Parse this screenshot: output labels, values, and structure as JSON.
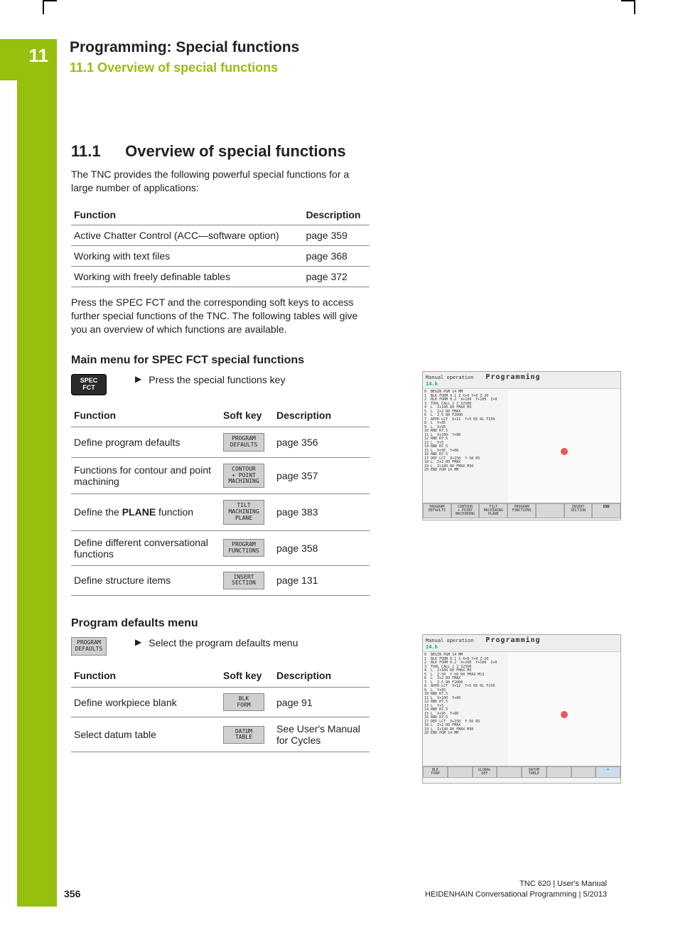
{
  "tab_number": "11",
  "header": {
    "chapter": "Programming: Special functions",
    "section_top": "11.1   Overview of special functions"
  },
  "section": {
    "number": "11.1",
    "title": "Overview of special functions",
    "intro": "The TNC provides the following powerful special functions for a large number of applications:",
    "overview_headers": {
      "c1": "Function",
      "c2": "Description"
    },
    "overview_rows": [
      {
        "fn": "Active Chatter Control (ACC—software option)",
        "desc": "page 359"
      },
      {
        "fn": "Working with text files",
        "desc": "page 368"
      },
      {
        "fn": "Working with freely definable tables",
        "desc": "page 372"
      }
    ],
    "note": "Press the SPEC FCT and the corresponding soft keys to access further special functions of the TNC. The following tables will give you an overview of which functions are available."
  },
  "spec_fct": {
    "heading": "Main menu for SPEC FCT special functions",
    "key_label": "SPEC\nFCT",
    "instruction": "Press the special functions key",
    "table_headers": {
      "c1": "Function",
      "c2": "Soft key",
      "c3": "Description"
    },
    "rows": [
      {
        "fn": "Define program defaults",
        "sk": "PROGRAM\nDEFAULTS",
        "desc": "page 356"
      },
      {
        "fn": "Functions for contour and point machining",
        "sk": "CONTOUR\n+ POINT\nMACHINING",
        "desc": "page 357"
      },
      {
        "fn_pre": "Define the ",
        "fn_bold": "PLANE",
        "fn_post": " function",
        "sk": "TILT\nMACHINING\nPLANE",
        "desc": "page 383"
      },
      {
        "fn": "Define different conversational functions",
        "sk": "PROGRAM\nFUNCTIONS",
        "desc": "page 358"
      },
      {
        "fn": "Define structure items",
        "sk": "INSERT\nSECTION",
        "desc": "page 131"
      }
    ]
  },
  "prog_defaults": {
    "heading": "Program defaults menu",
    "key_label": "PROGRAM\nDEFAULTS",
    "instruction": "Select the program defaults menu",
    "table_headers": {
      "c1": "Function",
      "c2": "Soft key",
      "c3": "Description"
    },
    "rows": [
      {
        "fn": "Define workpiece blank",
        "sk": "BLK\nFORM",
        "desc": "page 91"
      },
      {
        "fn": "Select datum table",
        "sk": "DATUM\nTABLE",
        "desc": "See User's Manual for Cycles"
      }
    ]
  },
  "screenshot1": {
    "mode": "Manual operation",
    "title": "Programming",
    "file": "14.h",
    "code": "0  BEGIN PGM 14 MM\n1  BLK FORM 0.1 Z X+0 Y+0 Z-20\n2  BLK FORM 0.2  X+100  Y+100  Z+0\n3  TOOL CALL 2 Z S2500\n4  L  Z+100 R0 FMAX M3\n5  L  Z+2 R0 FMAX\n6  L  Z-5 R0 F2000\n7  APPR LCT  X+12  Y+5 R5 RL F250\n8  L  Y+85\n9  L  X+95\n10 RND R7.5\n11 L  X+100  Y+80\n12 RND R7.5\n13 L  Y+5\n14 RND R7.5\n15 L  X+95  Y+80\n16 RND R7.5\n17 DEP LCT  X+150  Y-50 R5\n18 L  Z+2 R0 FMAX\n19 L  Z+100 R0 FMAX M30\n20 END PGM 14 MM",
    "softkeys": [
      "PROGRAM\nDEFAULTS",
      "CONTOUR\n+ POINT\nMACHINING",
      "TILT\nMACHINING\nPLANE",
      "PROGRAM\nFUNCTIONS",
      "",
      "INSERT\nSECTION",
      "END"
    ]
  },
  "screenshot2": {
    "mode": "Manual operation",
    "title": "Programming",
    "file": "14.h",
    "code": "0  BEGIN PGM 14 MM\n1  BLK FORM 0.1 Z X+0 Y+0 Z-20\n2  BLK FORM 0.2  X+100  Y+100  Z+0\n3  TOOL CALL 2 Z S2500\n4  L  Z+100 R0 FMAX M3\n5  L  Z-50  Y-50 R0 FMAX M13\n6  L  Z+2 R0 FMAX\n7  L  Z-5 R0 F2000\n8  APPR LCT  X+12  Y+5 R5 RL F250\n9  L  Y+85\n10 RND R7.5\n11 L  X+100  Y+80\n12 RND R7.5\n13 L  Y+5\n14 RND R7.5\n15 L  X+95  Y+80\n16 RND R7.5\n17 DEP LCT  X+150  Y-50 R5\n18 L  Z+2 R0 FMAX\n19 L  Z+100 R0 FMAX M30\n20 END PGM 14 MM",
    "softkeys": [
      "BLK\nFORM",
      "",
      "GLOBAL\nDEF",
      "",
      "DATUM\nTABLE",
      "",
      "",
      ""
    ]
  },
  "footer": {
    "page": "356",
    "line1": "TNC 620 | User's Manual",
    "line2": "HEIDENHAIN Conversational Programming | 5/2013"
  }
}
